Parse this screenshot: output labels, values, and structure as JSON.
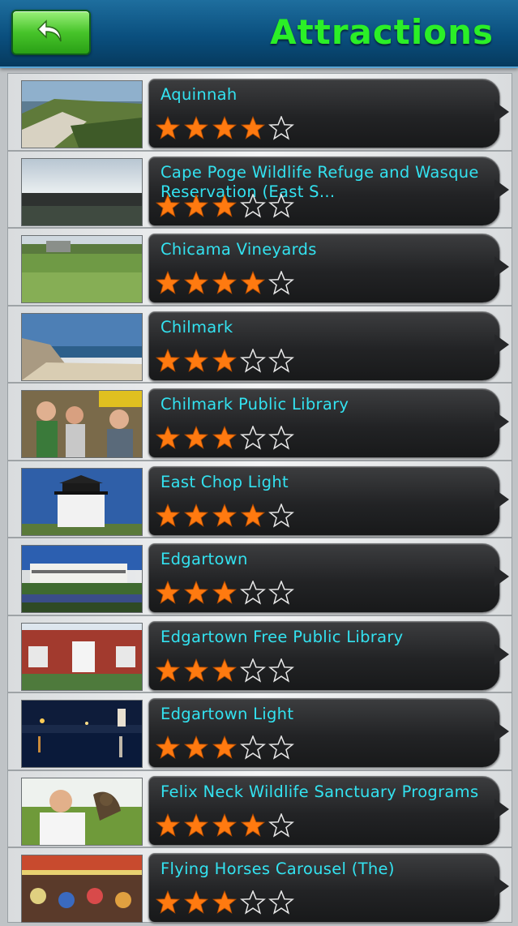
{
  "header": {
    "title": "Attractions",
    "back_label": "back"
  },
  "colors": {
    "title": "#2bef27",
    "item_text": "#33e2f0",
    "star_filled": "#ff7a10",
    "star_empty": "#e8e8e8"
  },
  "items": [
    {
      "name": "Aquinnah",
      "rating": 4,
      "thumb": "coast-cliffs"
    },
    {
      "name": "Cape Poge Wildlife Refuge and Wasque Reservation (East S...",
      "rating": 3,
      "thumb": "bay-sunset"
    },
    {
      "name": "Chicama Vineyards",
      "rating": 4,
      "thumb": "meadow-house"
    },
    {
      "name": "Chilmark",
      "rating": 3,
      "thumb": "beach"
    },
    {
      "name": "Chilmark Public Library",
      "rating": 3,
      "thumb": "crowd"
    },
    {
      "name": "East Chop Light",
      "rating": 4,
      "thumb": "lighthouse"
    },
    {
      "name": "Edgartown",
      "rating": 3,
      "thumb": "hotel-harbor"
    },
    {
      "name": "Edgartown Free Public Library",
      "rating": 3,
      "thumb": "brick-library"
    },
    {
      "name": "Edgartown Light",
      "rating": 3,
      "thumb": "night-harbor"
    },
    {
      "name": "Felix Neck Wildlife Sanctuary Programs",
      "rating": 4,
      "thumb": "owl-handler"
    },
    {
      "name": "Flying Horses Carousel (The)",
      "rating": 3,
      "thumb": "carousel"
    }
  ]
}
